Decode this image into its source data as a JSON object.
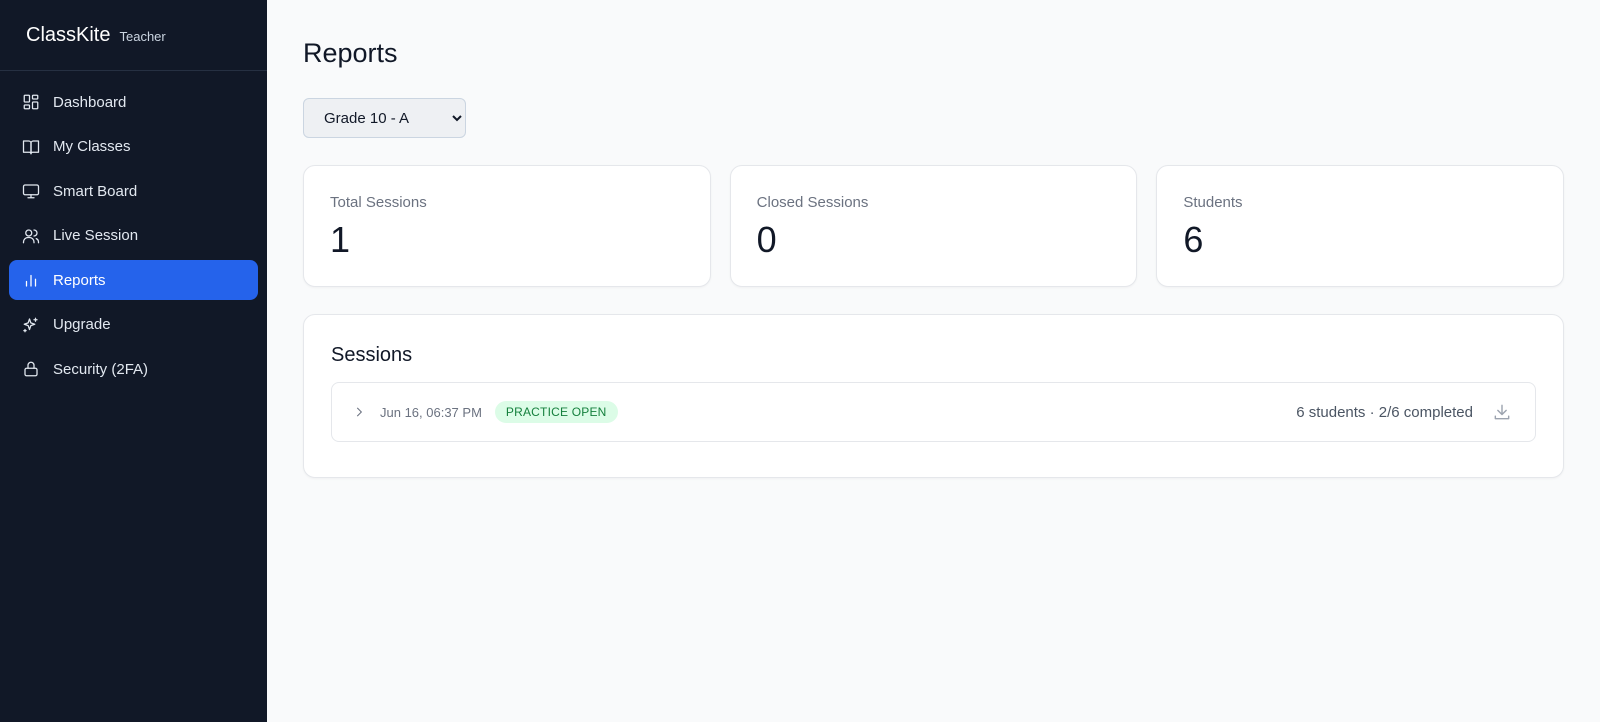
{
  "app": {
    "name": "ClassKite",
    "role": "Teacher"
  },
  "sidebar": {
    "items": [
      {
        "label": "Dashboard",
        "icon": "dashboard-icon",
        "active": false
      },
      {
        "label": "My Classes",
        "icon": "book-open-icon",
        "active": false
      },
      {
        "label": "Smart Board",
        "icon": "monitor-icon",
        "active": false
      },
      {
        "label": "Live Session",
        "icon": "users-icon",
        "active": false
      },
      {
        "label": "Reports",
        "icon": "bar-chart-icon",
        "active": true
      },
      {
        "label": "Upgrade",
        "icon": "sparkles-icon",
        "active": false
      },
      {
        "label": "Security (2FA)",
        "icon": "lock-icon",
        "active": false
      }
    ]
  },
  "main": {
    "title": "Reports",
    "class_select": {
      "selected": "Grade 10 - A",
      "options": [
        "Grade 10 - A"
      ]
    },
    "stats": [
      {
        "label": "Total Sessions",
        "value": "1"
      },
      {
        "label": "Closed Sessions",
        "value": "0"
      },
      {
        "label": "Students",
        "value": "6"
      }
    ],
    "sessions": {
      "title": "Sessions",
      "rows": [
        {
          "date": "Jun 16, 06:37 PM",
          "status": "PRACTICE OPEN",
          "summary": "6 students · 2/6 completed"
        }
      ]
    }
  },
  "colors": {
    "sidebar_bg": "#111827",
    "accent": "#2563eb",
    "badge_bg": "#dcfce7",
    "badge_text": "#15803d"
  }
}
